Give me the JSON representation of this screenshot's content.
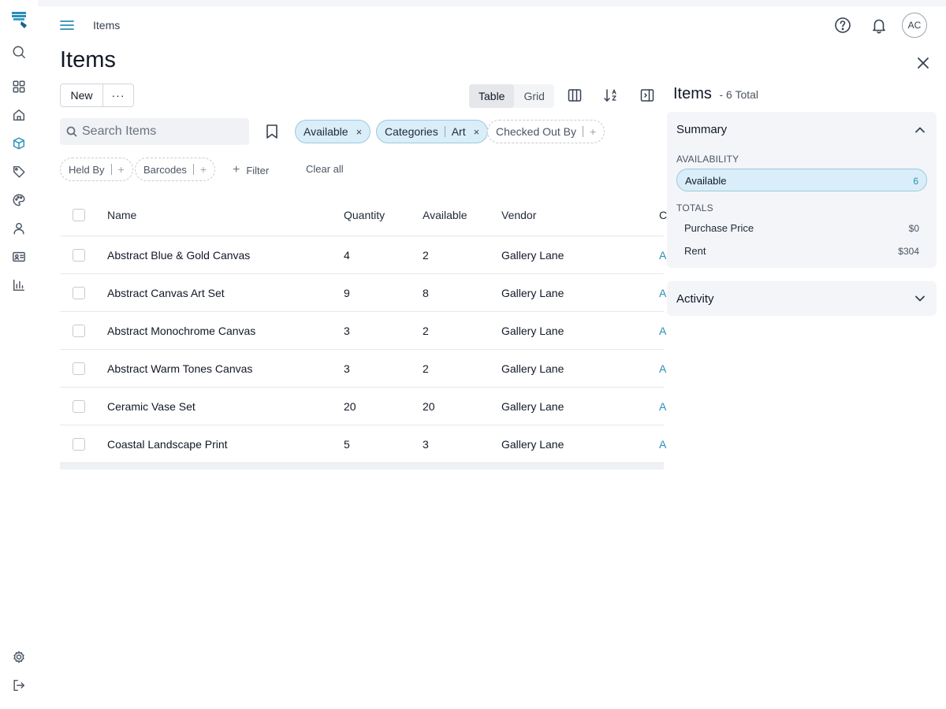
{
  "topbar": {
    "breadcrumb": "Items",
    "avatar_initials": "AC"
  },
  "page": {
    "title": "Items"
  },
  "toolbar": {
    "new_label": "New",
    "more_label": "···",
    "views": [
      "Table",
      "Grid"
    ],
    "active_view": "Table"
  },
  "search": {
    "placeholder": "Search Items"
  },
  "filters": {
    "available": "Available",
    "categories_key": "Categories",
    "categories_value": "Art",
    "checked_out_by": "Checked Out By",
    "held_by": "Held By",
    "barcodes": "Barcodes",
    "filter_label": "Filter",
    "clear_all": "Clear all",
    "plus": "+",
    "remove": "×"
  },
  "table": {
    "headers": {
      "name": "Name",
      "quantity": "Quantity",
      "available": "Available",
      "vendor": "Vendor",
      "category": "C"
    },
    "rows": [
      {
        "name": "Abstract Blue & Gold Canvas",
        "quantity": "4",
        "available": "2",
        "vendor": "Gallery Lane",
        "category": "A"
      },
      {
        "name": "Abstract Canvas Art Set",
        "quantity": "9",
        "available": "8",
        "vendor": "Gallery Lane",
        "category": "A"
      },
      {
        "name": "Abstract Monochrome Canvas",
        "quantity": "3",
        "available": "2",
        "vendor": "Gallery Lane",
        "category": "A"
      },
      {
        "name": "Abstract Warm Tones Canvas",
        "quantity": "3",
        "available": "2",
        "vendor": "Gallery Lane",
        "category": "A"
      },
      {
        "name": "Ceramic Vase Set",
        "quantity": "20",
        "available": "20",
        "vendor": "Gallery Lane",
        "category": "A"
      },
      {
        "name": "Coastal Landscape Print",
        "quantity": "5",
        "available": "3",
        "vendor": "Gallery Lane",
        "category": "A"
      }
    ]
  },
  "panel": {
    "title": "Items",
    "total": "- 6 Total",
    "summary": {
      "title": "Summary",
      "availability_label": "AVAILABILITY",
      "availability_item": "Available",
      "availability_count": "6",
      "totals_label": "TOTALS",
      "purchase_price_label": "Purchase Price",
      "purchase_price_value": "$0",
      "rent_label": "Rent",
      "rent_value": "$304"
    },
    "activity": {
      "title": "Activity"
    }
  },
  "icons": {
    "rail": [
      "logo-icon",
      "search-icon",
      "dashboard-icon",
      "home-icon",
      "box-icon",
      "tag-icon",
      "palette-icon",
      "user-icon",
      "id-card-icon",
      "bar-chart-icon",
      "gear-icon",
      "logout-icon"
    ],
    "active_rail": "box-icon"
  },
  "colors": {
    "accent": "#2a8fb8",
    "chip_active_bg": "#d9eef8",
    "panel_card_bg": "#f3f5f9"
  }
}
